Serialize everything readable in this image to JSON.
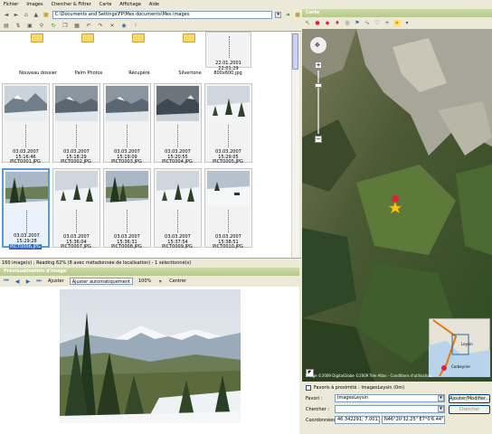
{
  "menu": [
    "Fichier",
    "Images",
    "Chercher & Filtrer",
    "Carte",
    "Affichage",
    "Aide"
  ],
  "address": {
    "path": "C:\\Documents and Settings\\FP\\Mes documents\\Mes images"
  },
  "folders": [
    {
      "label": "Nouveau dossier"
    },
    {
      "label": "Palm Photos"
    },
    {
      "label": "Récupéré"
    },
    {
      "label": "Silvertone"
    },
    {
      "label": "800x600.jpg",
      "date": "22.01.2001 22:01:29"
    }
  ],
  "thumbnails": [
    {
      "name": "PICT0001.JPG",
      "date": "03.03.2007 15:16:46",
      "scene": "mountain"
    },
    {
      "name": "PICT0002.JPG",
      "date": "03.03.2007 15:18:29",
      "scene": "mountain-cloudy"
    },
    {
      "name": "PICT0003.JPG",
      "date": "03.03.2007 15:19:09",
      "scene": "mountain-cloudy"
    },
    {
      "name": "PICT0004.JPG",
      "date": "03.03.2007 15:20:55",
      "scene": "mountain-dark"
    },
    {
      "name": "PICT0005.JPG",
      "date": "03.03.2007 15:29:05",
      "scene": "snow-trees"
    },
    {
      "name": "PICT0006.JPG",
      "date": "03.03.2007 15:29:28",
      "scene": "forest",
      "selected": true
    },
    {
      "name": "PICT0007.JPG",
      "date": "03.03.2007 15:36:04",
      "scene": "snow-trees"
    },
    {
      "name": "PICT0008.JPG",
      "date": "03.03.2007 15:36:31",
      "scene": "forest"
    },
    {
      "name": "PICT0009.JPG",
      "date": "03.03.2007 15:37:54",
      "scene": "snow-trees"
    },
    {
      "name": "PICT0010.JPG",
      "date": "03.03.2007 15:38:51",
      "scene": "snow-field"
    }
  ],
  "status": "160 image(s) ; Reading 62% (8 avec métadonnée de localisation) - 1 sélectionné(s)",
  "preview": {
    "title": "Prévisualisation d'image",
    "fit_label": "Ajuster",
    "auto_label": "Ajuster automatiquement",
    "zoom": "100%",
    "center_label": "Centrer"
  },
  "map": {
    "title": "Carte",
    "copyright": "Image ©2009 DigitalGlobe ©2009 Tele Atlas - Conditions d'utilisation",
    "mini_label": "Leysin",
    "mini_label2": "Corbeyrier"
  },
  "favorites": {
    "nearby_label": "Favoris à proximité : ImagesLeysin (0m)",
    "favoris_label": "Favori :",
    "favoris_value": "ImagesLeysin",
    "add_label": "Ajouter/Modifier...",
    "search_label": "Chercher :",
    "search_value": "",
    "search_button": "Chercher",
    "coords_label": "Coordonnées :",
    "coords_value": "46.342291; 7.001789",
    "coords_dms": "N46°20'32.25\" E7°0'6.44\""
  },
  "colors": {
    "panel_title": "#b6c98a",
    "selection": "#316ac5",
    "marker": "#e0203a"
  }
}
